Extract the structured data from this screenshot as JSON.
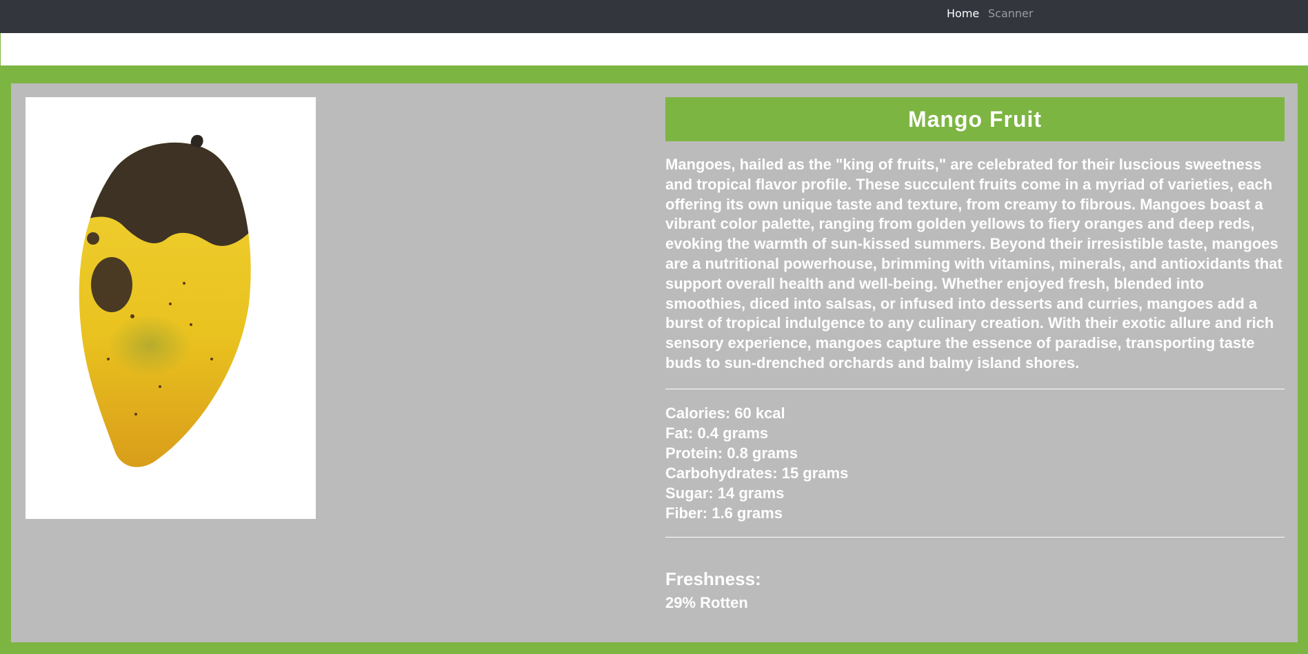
{
  "nav": {
    "home_label": "Home",
    "scanner_label": "Scanner"
  },
  "product": {
    "image_icon": "mango-photo",
    "title": "Mango Fruit",
    "description": "Mangoes, hailed as the \"king of fruits,\" are celebrated for their luscious sweetness and tropical flavor profile. These succulent fruits come in a myriad of varieties, each offering its own unique taste and texture, from creamy to fibrous. Mangoes boast a vibrant color palette, ranging from golden yellows to fiery oranges and deep reds, evoking the warmth of sun-kissed summers. Beyond their irresistible taste, mangoes are a nutritional powerhouse, brimming with vitamins, minerals, and antioxidants that support overall health and well-being. Whether enjoyed fresh, blended into smoothies, diced into salsas, or infused into desserts and curries, mangoes add a burst of tropical indulgence to any culinary creation. With their exotic allure and rich sensory experience, mangoes capture the essence of paradise, transporting taste buds to sun-drenched orchards and balmy island shores.",
    "nutrition": [
      "Calories: 60 kcal",
      "Fat: 0.4 grams",
      "Protein: 0.8 grams",
      "Carbohydrates: 15 grams",
      "Sugar: 14 grams",
      "Fiber: 1.6 grams"
    ],
    "freshness_label": "Freshness:",
    "freshness_value": "29% Rotten"
  },
  "colors": {
    "accent_green": "#7db543",
    "navbar": "#33363d",
    "panel_gray": "#bbbbbb"
  }
}
